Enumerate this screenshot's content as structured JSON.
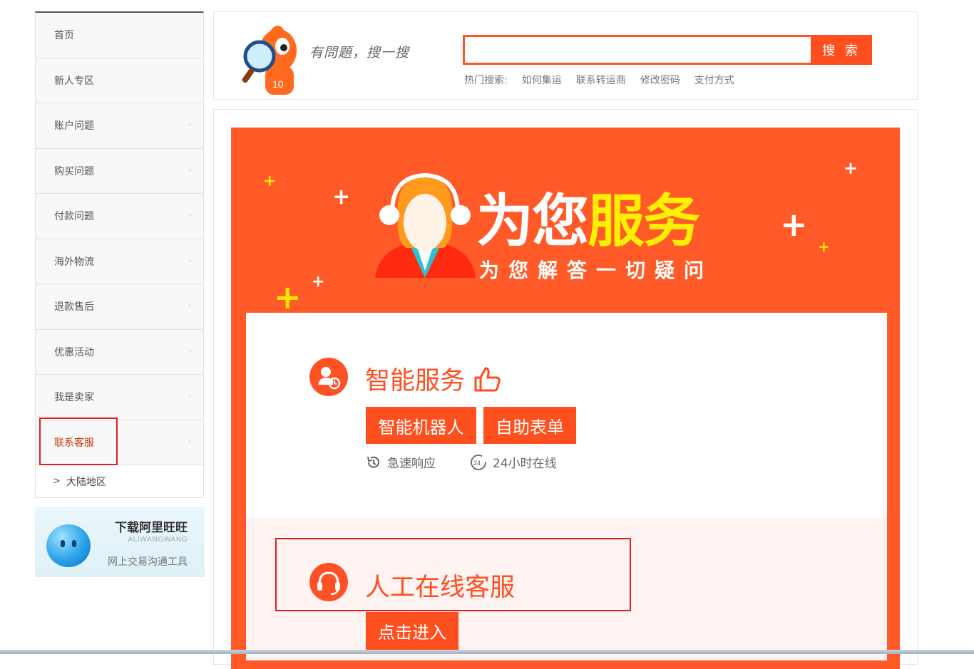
{
  "sidebar": {
    "items": [
      {
        "label": "首页"
      },
      {
        "label": "新人专区"
      },
      {
        "label": "账户问题"
      },
      {
        "label": "购买问题"
      },
      {
        "label": "付款问题"
      },
      {
        "label": "海外物流"
      },
      {
        "label": "退款售后"
      },
      {
        "label": "优惠活动"
      },
      {
        "label": "我是卖家"
      },
      {
        "label": "联系客服"
      }
    ],
    "sub_item": "大陆地区",
    "active": "联系客服"
  },
  "wangwang": {
    "title": "下载阿里旺旺",
    "en": "ALIWANGWANG",
    "subtitle": "网上交易沟通工具"
  },
  "header": {
    "slogan": "有問題，搜一搜",
    "search_value": "",
    "search_button": "搜 索",
    "hot_label": "热门搜索:",
    "hot_links": [
      "如何集运",
      "联系转运商",
      "修改密码",
      "支付方式"
    ]
  },
  "banner": {
    "title_white": "为您",
    "title_yellow": "服务",
    "subtitle": "为您解答一切疑问"
  },
  "smart_service": {
    "title": "智能服务",
    "buttons": [
      "智能机器人",
      "自助表单"
    ],
    "features": [
      "急速响应",
      "24小时在线"
    ],
    "badge_24": "24"
  },
  "human_service": {
    "title": "人工在线客服",
    "button": "点击进入"
  },
  "colors": {
    "brand_orange": "#ff5a28",
    "highlight_yellow": "#ffef00",
    "annotation_red": "#e02020"
  }
}
